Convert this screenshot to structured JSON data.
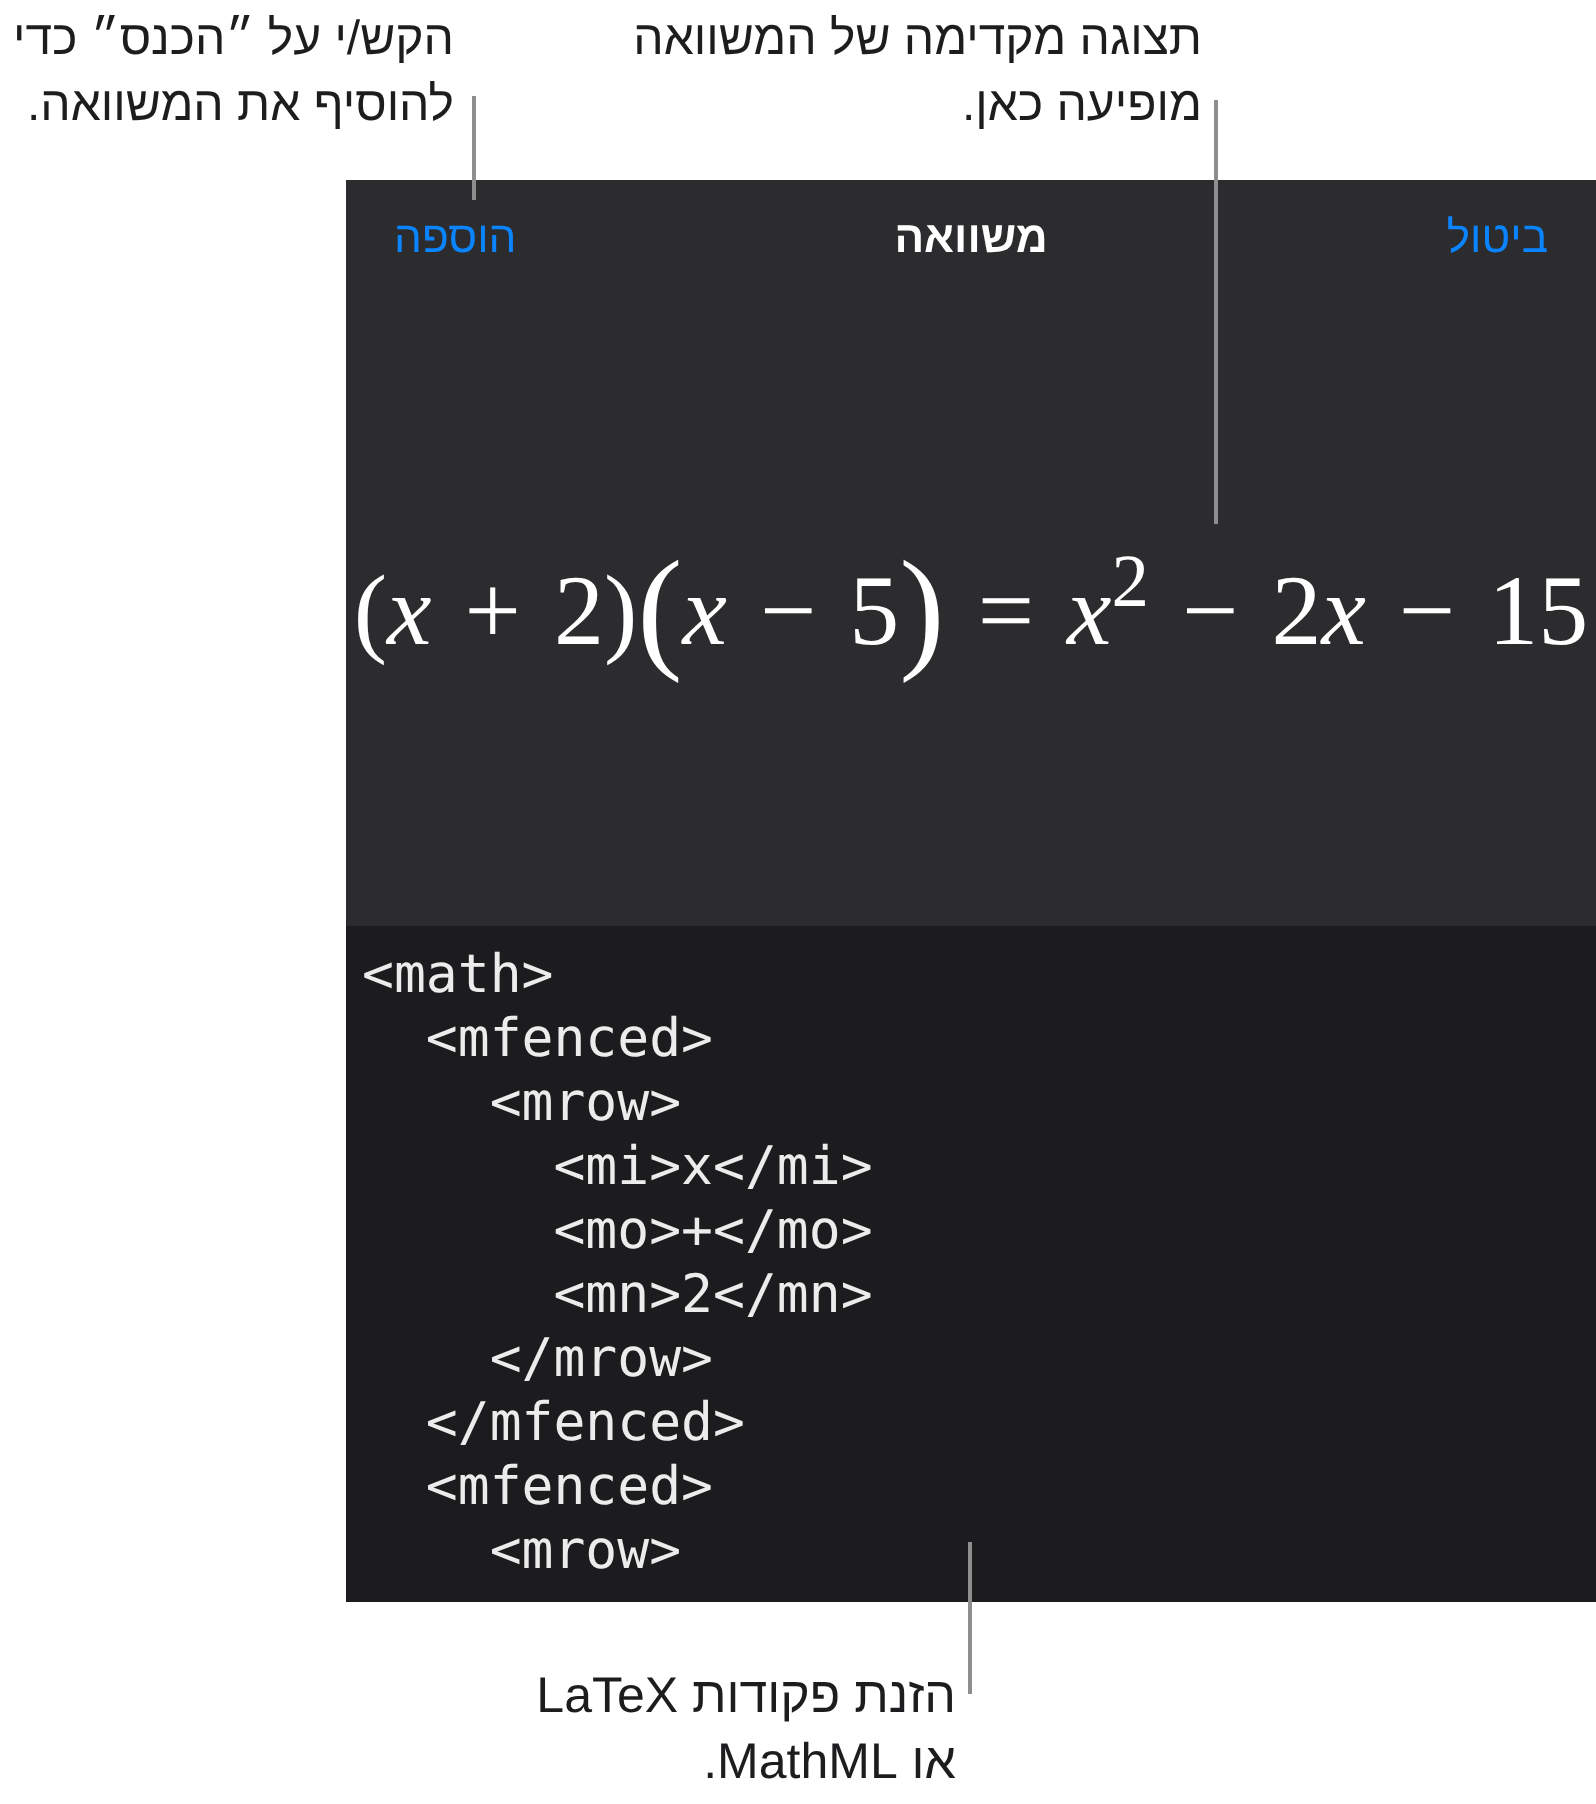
{
  "callout_add": "הקש/י על ״הכנס״ כדי\nלהוסיף את המשוואה.",
  "callout_preview": "תצוגה מקדימה של המשוואה\nמופיעה כאן.",
  "dialog": {
    "cancel_button": "ביטול",
    "title": "משוואה",
    "add_button": "הוספה",
    "equation": {
      "factor_1": "(*x* + 2)",
      "factor_2": {
        "open": "(",
        "body": "*x* − 5",
        "close": ")"
      },
      "equals": "=",
      "square_term": "*x*$^{2}$",
      "minus_1": "−",
      "coefficient": "2",
      "variable": "x",
      "minus_2": "−",
      "constant": "15"
    },
    "editor_value": "<math>\n  <mfenced>\n    <mrow>\n      <mi>x</mi>\n      <mo>+</mo>\n      <mn>2</mn>\n    </mrow>\n  </mfenced>\n  <mfenced>\n    <mrow>"
  },
  "callout_input": "הזנת פקודות LaTeX\nאו MathML."
}
